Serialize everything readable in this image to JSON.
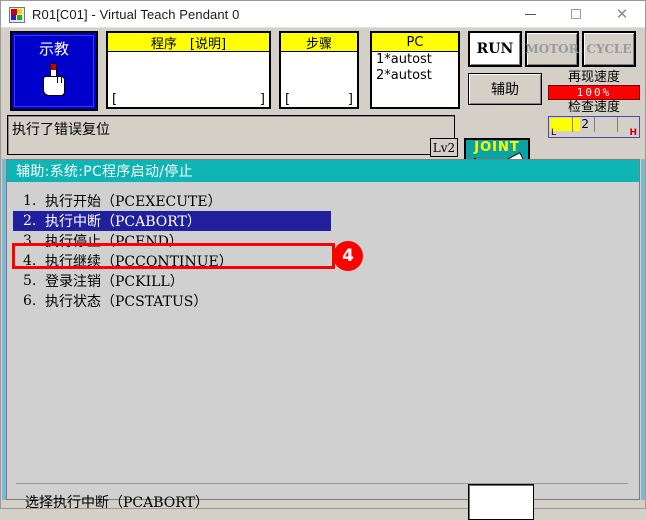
{
  "window": {
    "title": "R01[C01] - Virtual Teach Pendant 0",
    "icon": "app-icon",
    "controls": {
      "minimize": "—",
      "maximize": "□",
      "close": "✕"
    }
  },
  "toolbar": {
    "teach_button": {
      "label": "示教",
      "icon": "hand-pointer-icon"
    },
    "program_panel": {
      "header": "程序　[说明]",
      "open_bracket": "[",
      "close_bracket": "]"
    },
    "step_panel": {
      "header": "步骤",
      "open_bracket": "[",
      "close_bracket": "]"
    },
    "pc_panel": {
      "header": "PC",
      "line1": "1*autost",
      "line2": "2*autost"
    },
    "run_button": "RUN",
    "motor_button": "MOTOR",
    "cycle_button": "CYCLE",
    "aux_button": "辅助",
    "playback_speed_label": "再现速度",
    "playback_speed_value": "100%",
    "check_speed_label": "检查速度",
    "check_speed_value": "2",
    "check_speed_low": "L",
    "check_speed_high": "H"
  },
  "status": {
    "message": "执行了错误复位",
    "level_badge": "Lv2",
    "coord_mode": "JOINT"
  },
  "menu": {
    "header": "辅助:系统:PC程序启动/停止",
    "items": [
      {
        "num": "1.",
        "label": "执行开始（PCEXECUTE）",
        "selected": false
      },
      {
        "num": "2.",
        "label": "执行中断（PCABORT）",
        "selected": true
      },
      {
        "num": "3.",
        "label": "执行停止（PCEND）",
        "selected": false
      },
      {
        "num": "4.",
        "label": "执行继续（PCCONTINUE）",
        "selected": false
      },
      {
        "num": "5.",
        "label": "登录注销（PCKILL）",
        "selected": false
      },
      {
        "num": "6.",
        "label": "执行状态（PCSTATUS）",
        "selected": false
      }
    ]
  },
  "annotation": {
    "badge": "4",
    "color": "#ff0000"
  },
  "bottom": {
    "text": "选择执行中断（PCABORT）",
    "input_value": ""
  },
  "colors": {
    "accent_teal": "#0fb5b5",
    "selection_blue": "#20209c",
    "teach_blue": "#0000cd",
    "panel_yellow": "#ffff00",
    "speed_red": "#ff0000",
    "annotation_red": "#ff0000",
    "edge_blue": "#7bb7d6",
    "face_gray": "#d4d0c8"
  }
}
